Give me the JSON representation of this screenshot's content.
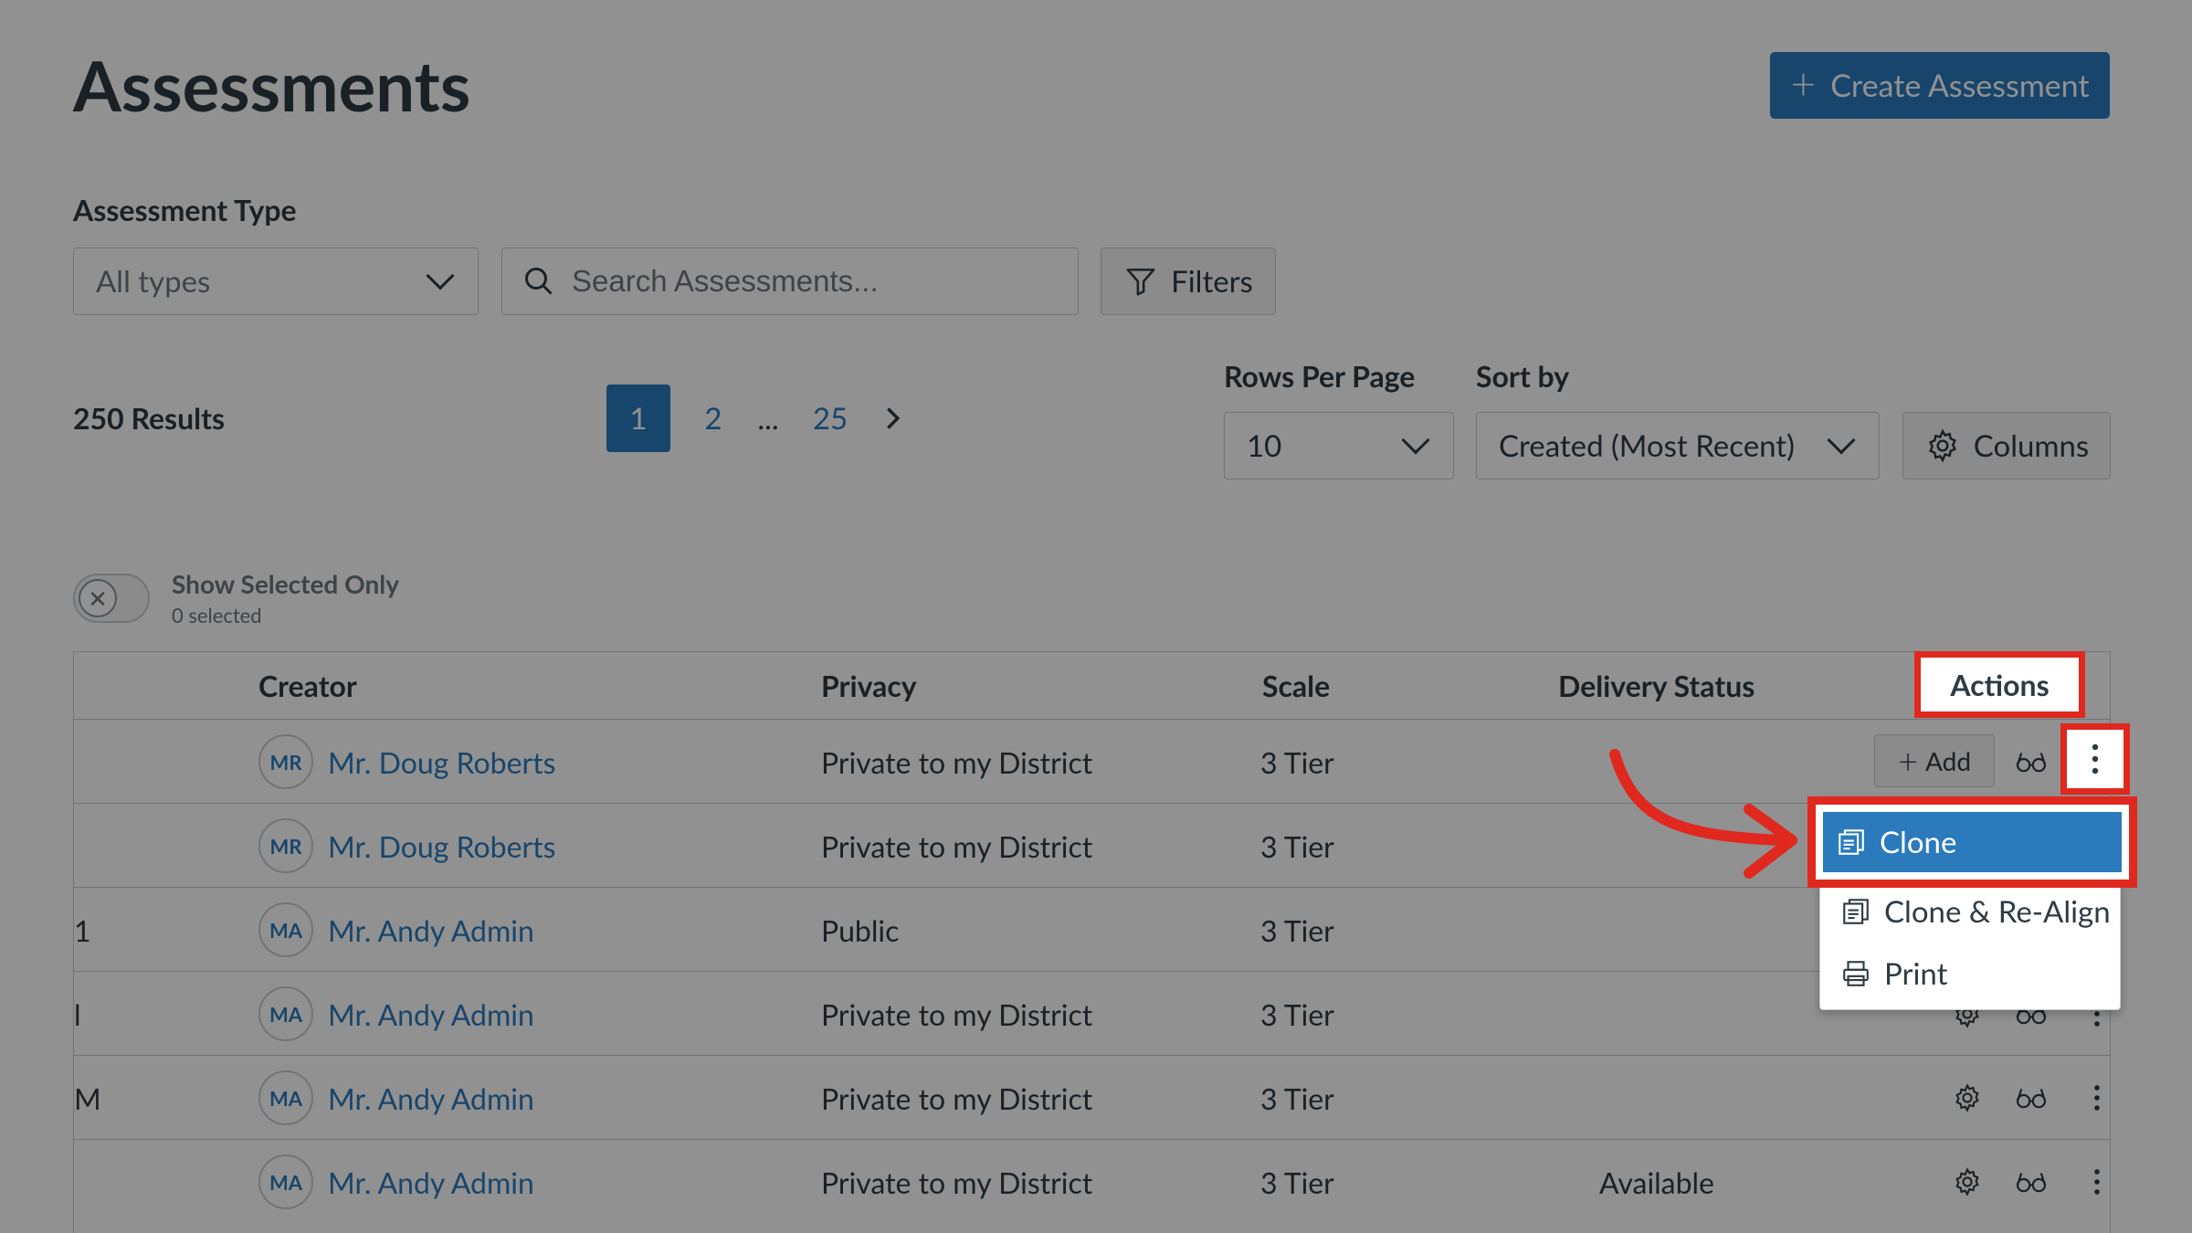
{
  "header": {
    "title": "Assessments",
    "create_button": "Create Assessment"
  },
  "filters": {
    "type_label": "Assessment Type",
    "type_value": "All types",
    "search_placeholder": "Search Assessments...",
    "filters_button": "Filters"
  },
  "results": {
    "count": "250 Results",
    "pages": [
      "1",
      "2",
      "...",
      "25"
    ],
    "current_page": "1"
  },
  "controls": {
    "rows_label": "Rows Per Page",
    "rows_value": "10",
    "sort_label": "Sort by",
    "sort_value": "Created (Most Recent)",
    "columns_button": "Columns"
  },
  "selection": {
    "toggle_label": "Show Selected Only",
    "selected_count": "0 selected"
  },
  "table": {
    "headers": [
      "Creator",
      "Privacy",
      "Scale",
      "Delivery Status",
      "Actions"
    ],
    "rows": [
      {
        "left": "",
        "initials": "MR",
        "creator": "Mr. Doug Roberts",
        "privacy": "Private to my District",
        "scale": "3 Tier",
        "status": ""
      },
      {
        "left": "",
        "initials": "MR",
        "creator": "Mr. Doug Roberts",
        "privacy": "Private to my District",
        "scale": "3 Tier",
        "status": ""
      },
      {
        "left": "1",
        "initials": "MA",
        "creator": "Mr. Andy Admin",
        "privacy": "Public",
        "scale": "3 Tier",
        "status": ""
      },
      {
        "left": "l",
        "initials": "MA",
        "creator": "Mr. Andy Admin",
        "privacy": "Private to my District",
        "scale": "3 Tier",
        "status": ""
      },
      {
        "left": "M",
        "initials": "MA",
        "creator": "Mr. Andy Admin",
        "privacy": "Private to my District",
        "scale": "3 Tier",
        "status": ""
      },
      {
        "left": "",
        "initials": "MA",
        "creator": "Mr. Andy Admin",
        "privacy": "Private to my District",
        "scale": "3 Tier",
        "status": "Available"
      }
    ],
    "add_label": "Add"
  },
  "actions_menu": {
    "items": [
      "Clone",
      "Clone & Re-Align",
      "Print"
    ]
  },
  "colors": {
    "primary": "#2b7abc",
    "highlight": "#e0281e",
    "text": "#2d3b45",
    "border": "#c7cdd1"
  }
}
